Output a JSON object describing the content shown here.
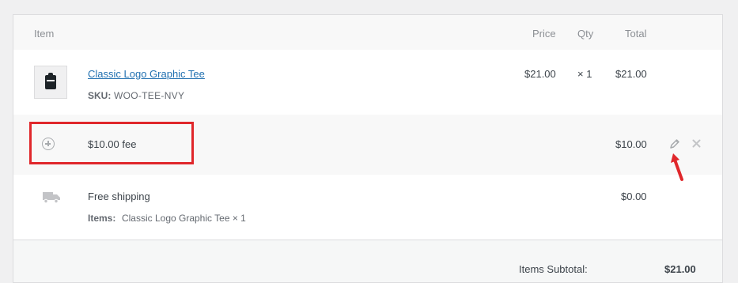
{
  "headers": {
    "item": "Item",
    "price": "Price",
    "qty": "Qty",
    "total": "Total"
  },
  "product": {
    "name": "Classic Logo Graphic Tee",
    "sku_label": "SKU:",
    "sku": "WOO-TEE-NVY",
    "price": "$21.00",
    "qty": "× 1",
    "total": "$21.00"
  },
  "fee": {
    "name": "$10.00 fee",
    "total": "$10.00"
  },
  "shipping": {
    "name": "Free shipping",
    "total": "$0.00",
    "items_label": "Items:",
    "items_value": "Classic Logo Graphic Tee × 1"
  },
  "totals": {
    "subtotal_label": "Items Subtotal:",
    "subtotal_value": "$21.00"
  },
  "annotation_color": "#e0272b"
}
